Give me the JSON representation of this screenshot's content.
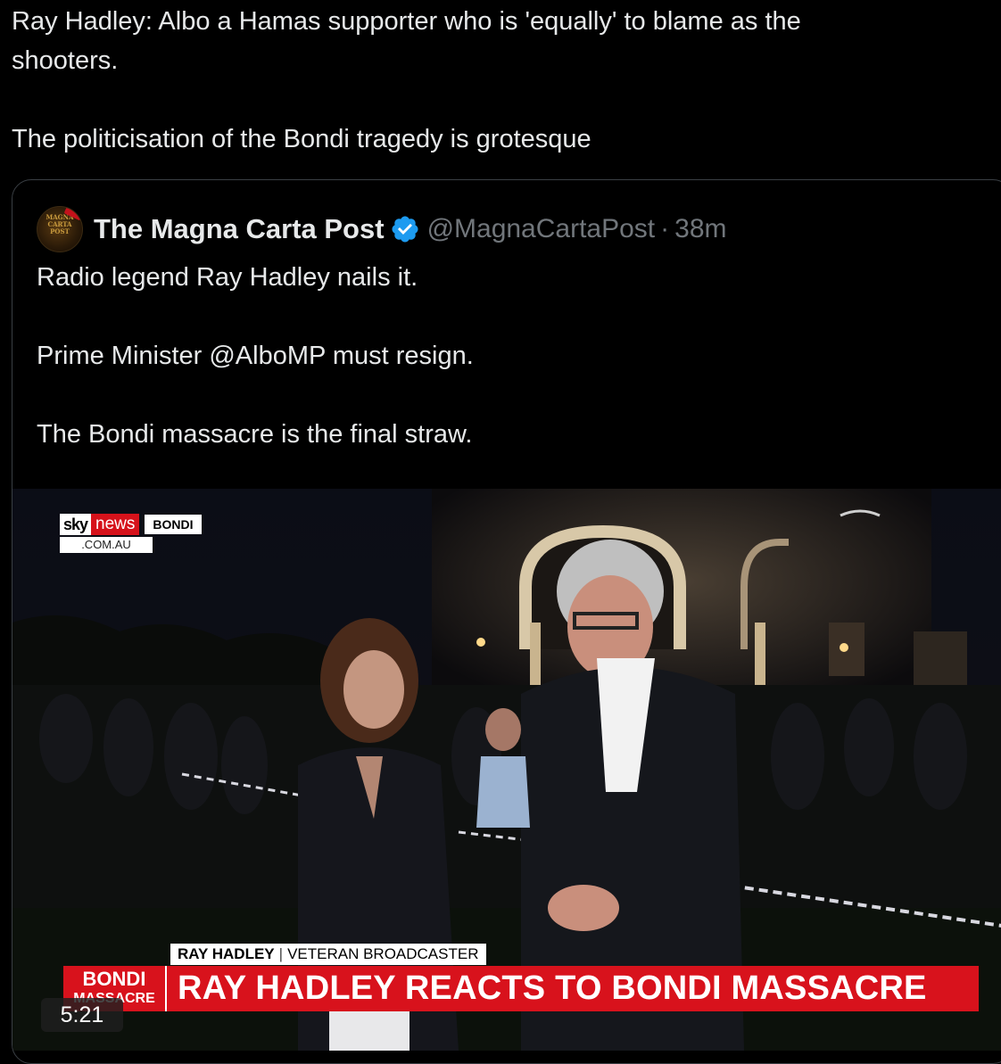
{
  "post": {
    "text_lines": [
      "Ray Hadley: Albo a Hamas supporter who is 'equally' to blame as the",
      "shooters.",
      "",
      "The politicisation of the Bondi tragedy is grotesque"
    ]
  },
  "quote": {
    "avatar": {
      "lines": [
        "MAGNA",
        "CARTA",
        "POST"
      ]
    },
    "author_name": "The Magna Carta Post",
    "verified_icon": "verified-badge-icon",
    "handle": "@MagnaCartaPost",
    "separator": "·",
    "time": "38m",
    "text_lines": [
      "Radio legend Ray Hadley nails it.",
      "",
      "Prime Minister @AlboMP must resign.",
      "",
      "The Bondi massacre is the final straw."
    ]
  },
  "video": {
    "brand": {
      "sky": "sky",
      "news": "news",
      "location_tag": "BONDI",
      "domain": ".COM.AU"
    },
    "name_plate": {
      "name": "RAY HADLEY",
      "separator": "|",
      "title": "VETERAN BROADCASTER"
    },
    "section_tag": {
      "line1": "BONDI",
      "line2": "MASSACRE"
    },
    "headline": "RAY HADLEY REACTS TO BONDI MASSACRE",
    "duration": "5:21",
    "colors": {
      "accent_red": "#d8121c",
      "verified_blue": "#1d9bf0"
    }
  }
}
